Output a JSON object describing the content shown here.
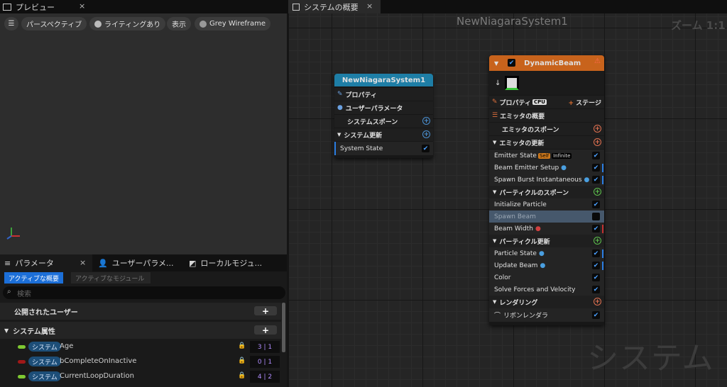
{
  "tabs": {
    "preview": "プレビュー",
    "system_overview": "システムの概要",
    "close": "×"
  },
  "preview_toolbar": {
    "perspective": "パースペクティブ",
    "lighting": "ライティングあり",
    "show": "表示",
    "wireframe": "Grey Wireframe"
  },
  "params_panel": {
    "tabs": [
      "パラメータ",
      "ユーザーパラメ...",
      "ローカルモジュ..."
    ],
    "subtab_active": "アクティブな概要",
    "subtab_inactive": "アクティブなモジュール",
    "search_placeholder": "検索",
    "section_user": "公開されたユーザー",
    "section_system": "システム属性",
    "rows": [
      {
        "ns": "システム",
        "name": "Age",
        "count": "3 | 1",
        "color": "#7ec832"
      },
      {
        "ns": "システム",
        "name": "bCompleteOnInactive",
        "count": "0 | 1",
        "color": "#a01818"
      },
      {
        "ns": "システム",
        "name": "CurrentLoopDuration",
        "count": "4 | 2",
        "color": "#7ec832"
      }
    ]
  },
  "graph": {
    "title": "NewNiagaraSystem1",
    "zoom": "ズーム 1:1",
    "watermark": "システム"
  },
  "system_node": {
    "title": "NewNiagaraSystem1",
    "properties": "プロパティ",
    "user_params": "ユーザーパラメータ",
    "system_spawn": "システムスポーン",
    "system_update": "システム更新",
    "system_state": "System State"
  },
  "emitter_node": {
    "title": "DynamicBeam",
    "properties": "プロパティ",
    "cpu": "CPU",
    "stage": "ステージ",
    "summary": "エミッタの概要",
    "spawn": "エミッタのスポーン",
    "update": "エミッタの更新",
    "emitter_state": "Emitter State",
    "self": "Self",
    "infinite": "Infinite",
    "beam_setup": "Beam Emitter Setup",
    "spawn_burst": "Spawn Burst Instantaneous",
    "particle_spawn": "パーティクルのスポーン",
    "init_particle": "Initialize Particle",
    "spawn_beam": "Spawn Beam",
    "beam_width": "Beam Width",
    "particle_update": "パーティクル更新",
    "particle_state": "Particle State",
    "update_beam": "Update Beam",
    "color": "Color",
    "solve": "Solve Forces and Velocity",
    "render": "レンダリング",
    "ribbon": "リボンレンダラ"
  },
  "colors": {
    "system_header": "#1e7ea6",
    "emitter_header": "#c8631c",
    "selected_row": "#46586c",
    "active_tab": "#1c6fd8"
  }
}
